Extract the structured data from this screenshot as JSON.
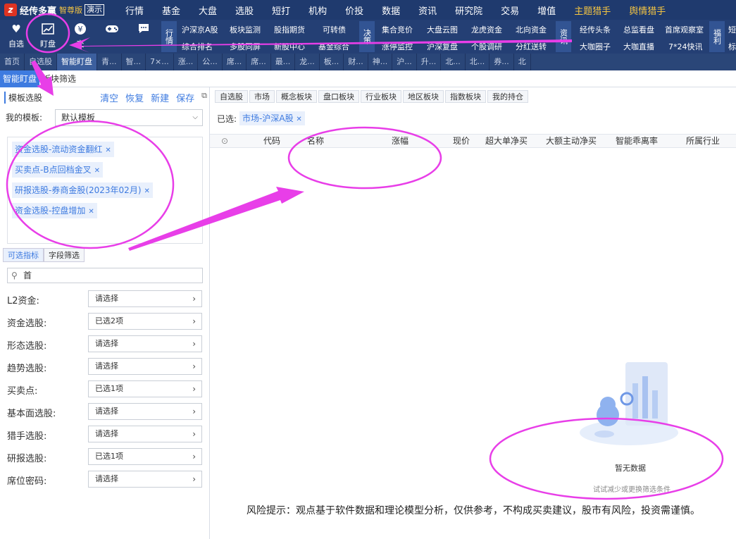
{
  "app": {
    "brand": "经传多赢",
    "edition": "智尊版",
    "demo": "演示"
  },
  "topmenu": [
    "行情",
    "基金",
    "大盘",
    "选股",
    "短打",
    "机构",
    "价投",
    "数据",
    "资讯",
    "研究院",
    "交易",
    "增值",
    "主题猎手",
    "舆情猎手"
  ],
  "topmenu_highlight": [
    "主题猎手",
    "舆情猎手"
  ],
  "toolbar": {
    "buttons": [
      {
        "label": "自选",
        "icon": "heart-icon"
      },
      {
        "label": "盯盘",
        "icon": "chart-icon"
      },
      {
        "label": "交",
        "icon": "yuan-icon"
      },
      {
        "label": "",
        "icon": "gamepad-icon"
      },
      {
        "label": "",
        "icon": "chat-icon"
      }
    ],
    "groups": [
      {
        "label": "行情",
        "row1": [
          "沪深京A股",
          "板块监测",
          "股指期货",
          "可转债"
        ],
        "row2": [
          "综合排名",
          "多股同屏",
          "新股中心",
          "基金综合"
        ]
      },
      {
        "label": "决策",
        "row1": [
          "集合竞价",
          "大盘云图",
          "龙虎资金",
          "北向资金"
        ],
        "row2": [
          "涨停监控",
          "沪深复盘",
          "个股调研",
          "分红送转"
        ]
      },
      {
        "label": "资讯",
        "row1": [
          "经传头条",
          "总监看盘",
          "首席观察室"
        ],
        "row2": [
          "大咖圈子",
          "大咖直播",
          "7*24快讯"
        ]
      },
      {
        "label": "福利",
        "row1": [
          "短"
        ],
        "row2": [
          "标"
        ]
      }
    ]
  },
  "tabs": [
    "首页",
    "自选股",
    "智能盯盘",
    "青...",
    "智...",
    "7×...",
    "涨...",
    "公...",
    "席...",
    "席...",
    "最...",
    "龙...",
    "板...",
    "财...",
    "神...",
    "沪...",
    "升...",
    "北...",
    "北...",
    "券...",
    "北"
  ],
  "active_tab": "智能盯盘",
  "subtabs": [
    "智能盯盘",
    "板块筛选"
  ],
  "left": {
    "title": "模板选股",
    "actions": [
      "清空",
      "恢复",
      "新建",
      "保存"
    ],
    "my_template_label": "我的模板:",
    "my_template_value": "默认模板",
    "tags": [
      "资金选股-流动资金翻红",
      "买卖点-B点回档金叉",
      "研报选股-券商金股(2023年02月)",
      "资金选股-控盘增加"
    ],
    "filter_tabs": [
      "可选指标",
      "字段筛选"
    ],
    "search_value": "首",
    "filters": [
      {
        "label": "L2资金:",
        "value": "请选择"
      },
      {
        "label": "资金选股:",
        "value": "已选2项"
      },
      {
        "label": "形态选股:",
        "value": "请选择"
      },
      {
        "label": "趋势选股:",
        "value": "请选择"
      },
      {
        "label": "买卖点:",
        "value": "已选1项"
      },
      {
        "label": "基本面选股:",
        "value": "请选择"
      },
      {
        "label": "猎手选股:",
        "value": "请选择"
      },
      {
        "label": "研报选股:",
        "value": "已选1项"
      },
      {
        "label": "席位密码:",
        "value": "请选择"
      }
    ]
  },
  "main": {
    "categories": [
      "自选股",
      "市场",
      "概念板块",
      "盘口板块",
      "行业板块",
      "地区板块",
      "指数板块",
      "我的持仓"
    ],
    "selected_label": "已选:",
    "selected_chip": "市场-沪深A股",
    "columns": [
      "代码",
      "名称",
      "涨幅",
      "现价",
      "超大单净买",
      "大额主动净买",
      "智能乖离率",
      "所属行业"
    ],
    "empty_title": "暂无数据",
    "empty_sub": "试试减少或更换筛选条件",
    "risk": "风险提示：观点基于软件数据和理论模型分析，仅供参考，不构成买卖建议，股市有风险，投资需谨慎。"
  },
  "colors": {
    "accent": "#3e7be0",
    "topbar": "#1f3a6e",
    "annotation": "#e83ee8"
  }
}
